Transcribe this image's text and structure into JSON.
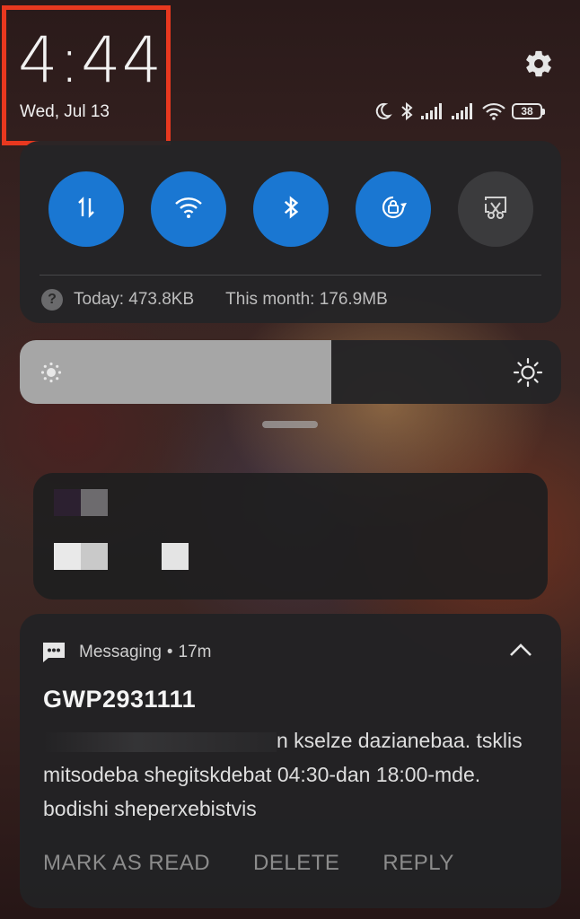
{
  "header": {
    "time": "4:44",
    "date": "Wed, Jul 13",
    "battery": "38",
    "icons": [
      "moon-icon",
      "bluetooth-icon",
      "signal-icon",
      "signal-icon",
      "wifi-icon",
      "battery-icon"
    ],
    "highlight_color": "#e8381f"
  },
  "quick_settings": {
    "toggles": [
      {
        "name": "mobile-data-icon",
        "state": "on"
      },
      {
        "name": "wifi-icon",
        "state": "on"
      },
      {
        "name": "bluetooth-icon",
        "state": "on"
      },
      {
        "name": "rotation-lock-icon",
        "state": "on"
      },
      {
        "name": "screenshot-icon",
        "state": "off"
      }
    ],
    "accent": "#1a77d2",
    "data_today": "Today: 473.8KB",
    "data_month": "This month: 176.9MB"
  },
  "brightness": {
    "level": 0.575
  },
  "notification": {
    "app": "Messaging",
    "separator": "•",
    "time_ago": "17m",
    "sender": "GWP2931111",
    "body_line1": "n kselze dazianebaa.",
    "body_rest": "tsklis mitsodeba shegitskdebat 04:30-dan 18:00-mde. bodishi sheperxebistvis",
    "actions": {
      "mark_read": "MARK AS READ",
      "delete": "DELETE",
      "reply": "REPLY"
    }
  }
}
